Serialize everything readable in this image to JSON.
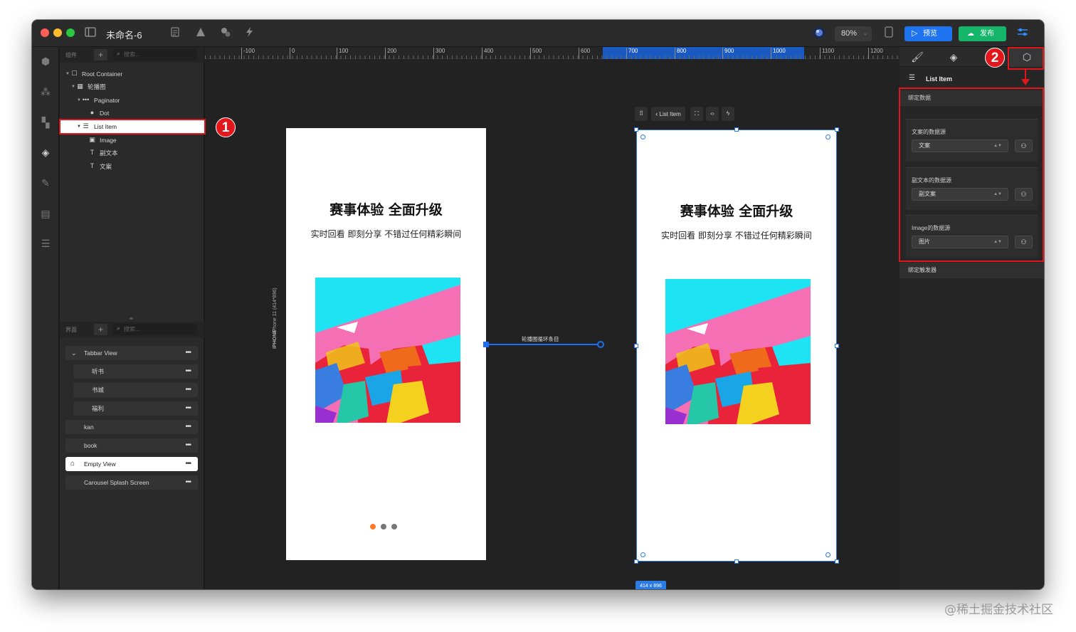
{
  "window": {
    "title": "未命名-6",
    "traffic_lights": {
      "close": "#fe5f57",
      "minimize": "#febc2e",
      "maximize": "#28c840"
    },
    "toolbar_icons": [
      "sidebar-icon",
      "document-icon",
      "shapes-icon",
      "components-icon",
      "lightning-icon"
    ]
  },
  "header": {
    "zoom": "80%",
    "preview_label": "预览",
    "publish_label": "发布",
    "colors": {
      "preview": "#1e74f0",
      "publish": "#15b56a"
    }
  },
  "left_panel": {
    "components_tab": "组件",
    "search_placeholder": "搜索...",
    "tree": [
      {
        "label": "Root Container",
        "icon": "square-icon",
        "depth": 0
      },
      {
        "label": "轮播图",
        "icon": "carousel-icon",
        "depth": 1
      },
      {
        "label": "Paginator",
        "icon": "dots-icon",
        "depth": 2
      },
      {
        "label": "Dot",
        "icon": "dot-icon",
        "depth": 3
      },
      {
        "label": "List Item",
        "icon": "list-item-icon",
        "depth": 2,
        "selected": true
      },
      {
        "label": "Image",
        "icon": "image-icon",
        "depth": 3
      },
      {
        "label": "副文本",
        "icon": "text-icon",
        "depth": 3
      },
      {
        "label": "文案",
        "icon": "text-icon",
        "depth": 3
      }
    ],
    "pages_tab": "界面",
    "pages_search_placeholder": "搜索...",
    "pages": [
      {
        "label": "Tabbar View",
        "indent": 0,
        "has_caret": true
      },
      {
        "label": "听书",
        "indent": 1
      },
      {
        "label": "书城",
        "indent": 1
      },
      {
        "label": "福利",
        "indent": 1
      },
      {
        "label": "kan",
        "indent": 0
      },
      {
        "label": "book",
        "indent": 0
      },
      {
        "label": "Empty View",
        "indent": 0,
        "active": true,
        "icon": "home-icon"
      },
      {
        "label": "Carousel Splash Screen",
        "indent": 0
      }
    ]
  },
  "ruler": {
    "labels": [
      "-100",
      "0",
      "100",
      "200",
      "300",
      "400",
      "500",
      "600",
      "700",
      "800",
      "900",
      "1000",
      "1100",
      "1200"
    ],
    "highlight_color": "#1a5fd1"
  },
  "canvas": {
    "side_label_device": "IPHONE",
    "side_label_size": "iPhone 11 (414*896)",
    "left_phone": {
      "title": "赛事体验 全面升级",
      "subtitle": "实时回看 即刻分享 不错过任何精彩瞬间"
    },
    "right_phone": {
      "title": "赛事体验 全面升级",
      "subtitle": "实时回看 即刻分享 不错过任何精彩瞬间"
    },
    "connector_label": "轮播图循环条目",
    "mini_toolbar_label": "List Item",
    "size_badge": "414 x 896",
    "dots": {
      "active": "#ff7a2e",
      "inactive": "#777777"
    }
  },
  "right_panel": {
    "tab_icons": [
      "brush-icon",
      "diamond-icon",
      "box-bind-icon"
    ],
    "component_name": "List Item",
    "section_bind_data": "绑定数据",
    "bindings": [
      {
        "label": "文案的数据源",
        "value": "文案"
      },
      {
        "label": "副文本的数据源",
        "value": "副文案"
      },
      {
        "label": "Image的数据源",
        "value": "图片"
      }
    ],
    "section_bind_trigger": "绑定触发器"
  },
  "annotations": {
    "badge_1": "1",
    "badge_2": "2",
    "color": "#e3161c"
  },
  "watermark": "@稀土掘金技术社区"
}
